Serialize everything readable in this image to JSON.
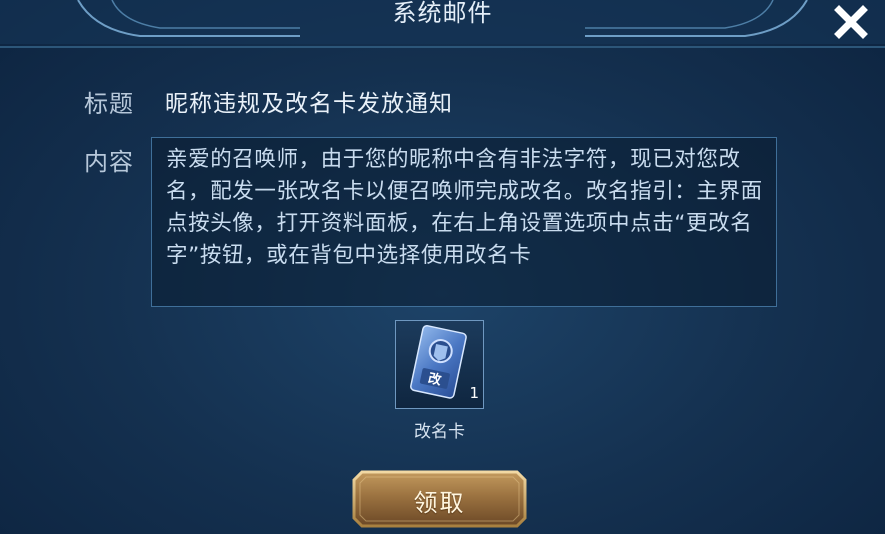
{
  "dialog": {
    "title": "系统邮件",
    "close_icon": "close-icon"
  },
  "mail": {
    "subject_label": "标题",
    "subject_value": "昵称违规及改名卡发放通知",
    "content_label": "内容",
    "content_text": "亲爱的召唤师，由于您的昵称中含有非法字符，现已对您改名，配发一张改名卡以便召唤师完成改名。改名指引：主界面点按头像，打开资料面板，在右上角设置选项中点击“更改名字”按钮，或在背包中选择使用改名卡"
  },
  "attachment": {
    "icon": "rename-card-icon",
    "icon_glyph": "改",
    "count": "1",
    "name": "改名卡"
  },
  "actions": {
    "claim_label": "领取"
  },
  "colors": {
    "background": "#14304f",
    "panel_border": "#3f6f99",
    "button_gold": "#b88a4e",
    "button_brown": "#6a4a2a"
  }
}
